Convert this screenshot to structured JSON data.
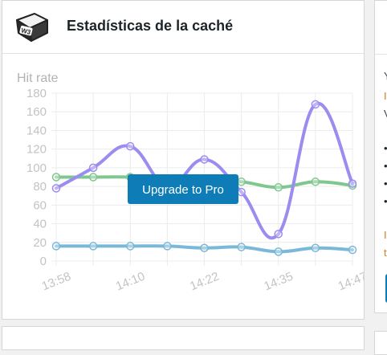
{
  "widget": {
    "title": "Estadísticas de la caché",
    "logo_text": "W3",
    "upgrade_button_label": "Upgrade to Pro"
  },
  "colors": {
    "series_hit_rate": "#9b8cf0",
    "series_green": "#7fc78f",
    "series_blue": "#7ab8d8",
    "button": "#0e7cb6",
    "orange_text": "#d27e1d"
  },
  "chart_data": {
    "type": "line",
    "title": "Hit rate",
    "x": [
      "13:58",
      "14:04",
      "14:10",
      "14:16",
      "14:22",
      "14:28",
      "14:35",
      "14:41",
      "14:47"
    ],
    "x_tick_labels": [
      "13:58",
      "14:10",
      "14:22",
      "14:35",
      "14:47"
    ],
    "ylim": [
      0,
      180
    ],
    "y_ticks": [
      0,
      20,
      40,
      60,
      80,
      100,
      120,
      140,
      160,
      180
    ],
    "grid": true,
    "series": [
      {
        "values": [
          78,
          100,
          123,
          80,
          109,
          74,
          29,
          168,
          83
        ]
      },
      {
        "values": [
          90,
          90,
          90,
          87,
          87,
          85,
          79,
          85,
          81
        ]
      },
      {
        "values": [
          16,
          16,
          16,
          16,
          14,
          15,
          10,
          14,
          12
        ]
      }
    ]
  },
  "right_panel": {
    "marks": [
      {
        "text": "Y",
        "color": "#3c434a"
      },
      {
        "text": "I",
        "color": "#d27e1d"
      },
      {
        "text": "V",
        "color": "#3c434a"
      },
      {
        "text": "•",
        "color": "#1d2327"
      },
      {
        "text": "•",
        "color": "#1d2327"
      },
      {
        "text": "•",
        "color": "#1d2327"
      },
      {
        "text": "•",
        "color": "#1d2327"
      },
      {
        "text": "I",
        "color": "#d27e1d"
      },
      {
        "text": "t",
        "color": "#d27e1d"
      }
    ]
  }
}
